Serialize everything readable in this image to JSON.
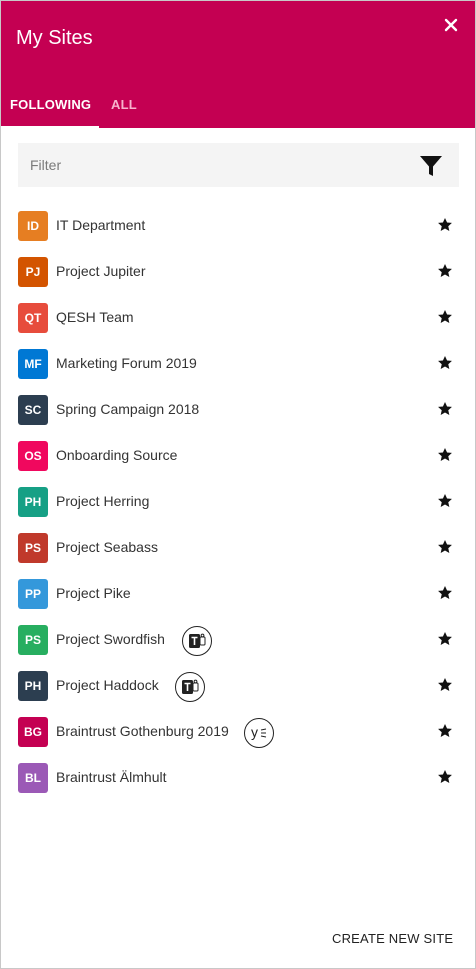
{
  "header": {
    "title": "My Sites",
    "close_icon": "close-icon",
    "accent_color": "#c40052"
  },
  "tabs": [
    {
      "label": "FOLLOWING",
      "active": true
    },
    {
      "label": "ALL",
      "active": false
    }
  ],
  "filter": {
    "placeholder": "Filter",
    "value": "",
    "icon": "filter-icon"
  },
  "sites": [
    {
      "initials": "ID",
      "name": "IT Department",
      "color": "#e67e22",
      "badge": null,
      "starred": true
    },
    {
      "initials": "PJ",
      "name": "Project Jupiter",
      "color": "#d35400",
      "badge": null,
      "starred": true
    },
    {
      "initials": "QT",
      "name": "QESH Team",
      "color": "#e74c3c",
      "badge": null,
      "starred": true
    },
    {
      "initials": "MF",
      "name": "Marketing Forum 2019",
      "color": "#0078d4",
      "badge": null,
      "starred": true
    },
    {
      "initials": "SC",
      "name": "Spring Campaign 2018",
      "color": "#2c3e50",
      "badge": null,
      "starred": true
    },
    {
      "initials": "OS",
      "name": "Onboarding Source",
      "color": "#f0085e",
      "badge": null,
      "starred": true
    },
    {
      "initials": "PH",
      "name": "Project Herring",
      "color": "#16a085",
      "badge": null,
      "starred": true
    },
    {
      "initials": "PS",
      "name": "Project Seabass",
      "color": "#c0392b",
      "badge": null,
      "starred": true
    },
    {
      "initials": "PP",
      "name": "Project Pike",
      "color": "#3498db",
      "badge": null,
      "starred": true
    },
    {
      "initials": "PS",
      "name": "Project Swordfish",
      "color": "#27ae60",
      "badge": "teams-icon",
      "starred": true
    },
    {
      "initials": "PH",
      "name": "Project Haddock",
      "color": "#2c3e50",
      "badge": "teams-icon",
      "starred": true
    },
    {
      "initials": "BG",
      "name": "Braintrust Gothenburg 2019",
      "color": "#c40052",
      "badge": "yammer-icon",
      "starred": true
    },
    {
      "initials": "BL",
      "name": "Braintrust Älmhult",
      "color": "#9b59b6",
      "badge": null,
      "starred": true
    }
  ],
  "footer": {
    "create_label": "CREATE NEW SITE"
  }
}
